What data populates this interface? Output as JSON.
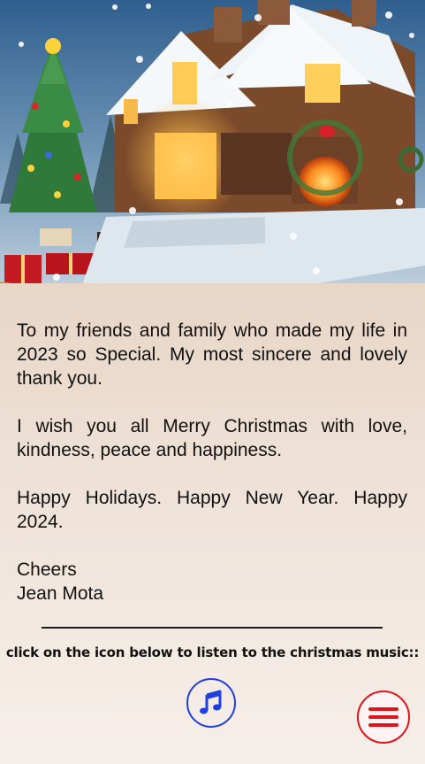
{
  "message": {
    "paragraph1": "To my friends and family who made my life in 2023 so Special. My most sincere and lovely thank you.",
    "paragraph2": "I wish you all Merry Christmas with love, kindness, peace and happiness.",
    "paragraph3": "Happy Holidays. Happy New Year. Happy 2024.",
    "closing": "Cheers",
    "signature": "Jean Mota"
  },
  "instruction_text": "click on the icon below to listen to the christmas music::",
  "icons": {
    "music": "music-note-icon",
    "menu": "hamburger-menu-icon"
  },
  "colors": {
    "music_accent": "#1f3fe0",
    "menu_accent": "#e0141b",
    "background": "#f1e7df",
    "gold_wave": "#c89a2a"
  }
}
